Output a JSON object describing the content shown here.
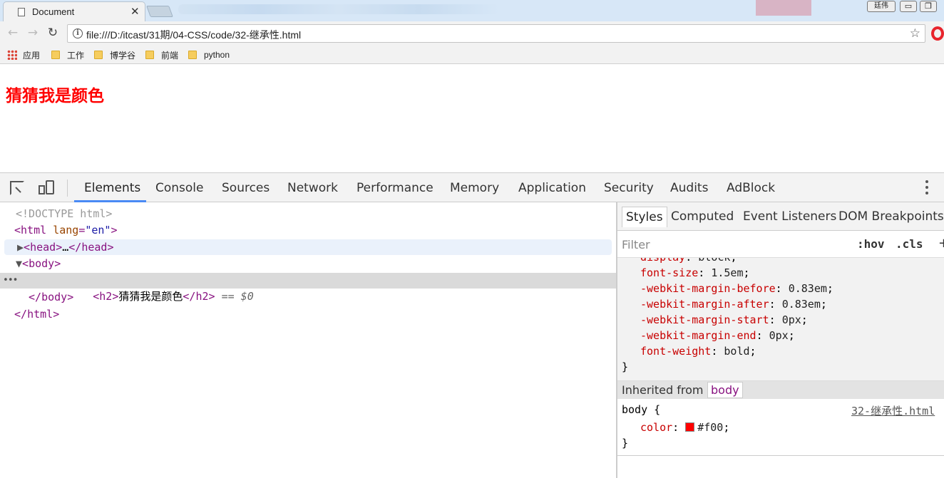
{
  "tab": {
    "title": "Document"
  },
  "window": {
    "user_badge": "廷伟"
  },
  "toolbar": {
    "url": "file:///D:/itcast/31期/04-CSS/code/32-继承性.html"
  },
  "bookmarks": [
    {
      "label": "应用",
      "icon": "apps-grid-icon"
    },
    {
      "label": "工作",
      "icon": "folder-icon"
    },
    {
      "label": "博学谷",
      "icon": "folder-icon"
    },
    {
      "label": "前端",
      "icon": "folder-icon"
    },
    {
      "label": "python",
      "icon": "folder-icon"
    }
  ],
  "page": {
    "heading": "猜猜我是颜色",
    "heading_color": "#ff0000"
  },
  "devtools": {
    "tabs": [
      "Elements",
      "Console",
      "Sources",
      "Network",
      "Performance",
      "Memory",
      "Application",
      "Security",
      "Audits",
      "AdBlock"
    ],
    "active_tab": "Elements",
    "dom": {
      "doctype": "<!DOCTYPE html>",
      "html_open": "html",
      "lang_attr": "lang",
      "lang_val": "\"en\"",
      "head_collapsed": "head",
      "body_tag": "body",
      "h2_tag": "h2",
      "h2_text": "猜猜我是颜色",
      "selected_marker": "== $0"
    },
    "styles": {
      "tabs": [
        "Styles",
        "Computed",
        "Event Listeners",
        "DOM Breakpoints"
      ],
      "filter_placeholder": "Filter",
      "hov": ":hov",
      "cls": ".cls",
      "ua_rules": [
        {
          "prop": "display",
          "value": "block"
        },
        {
          "prop": "font-size",
          "value": "1.5em"
        },
        {
          "prop": "-webkit-margin-before",
          "value": "0.83em"
        },
        {
          "prop": "-webkit-margin-after",
          "value": "0.83em"
        },
        {
          "prop": "-webkit-margin-start",
          "value": "0px"
        },
        {
          "prop": "-webkit-margin-end",
          "value": "0px"
        },
        {
          "prop": "font-weight",
          "value": "bold"
        }
      ],
      "inherited_label": "Inherited from",
      "inherited_from": "body",
      "body_rule": {
        "selector": "body {",
        "source": "32-继承性.html",
        "prop": "color",
        "value": "#f00",
        "swatch_color": "#ff0000"
      }
    }
  }
}
